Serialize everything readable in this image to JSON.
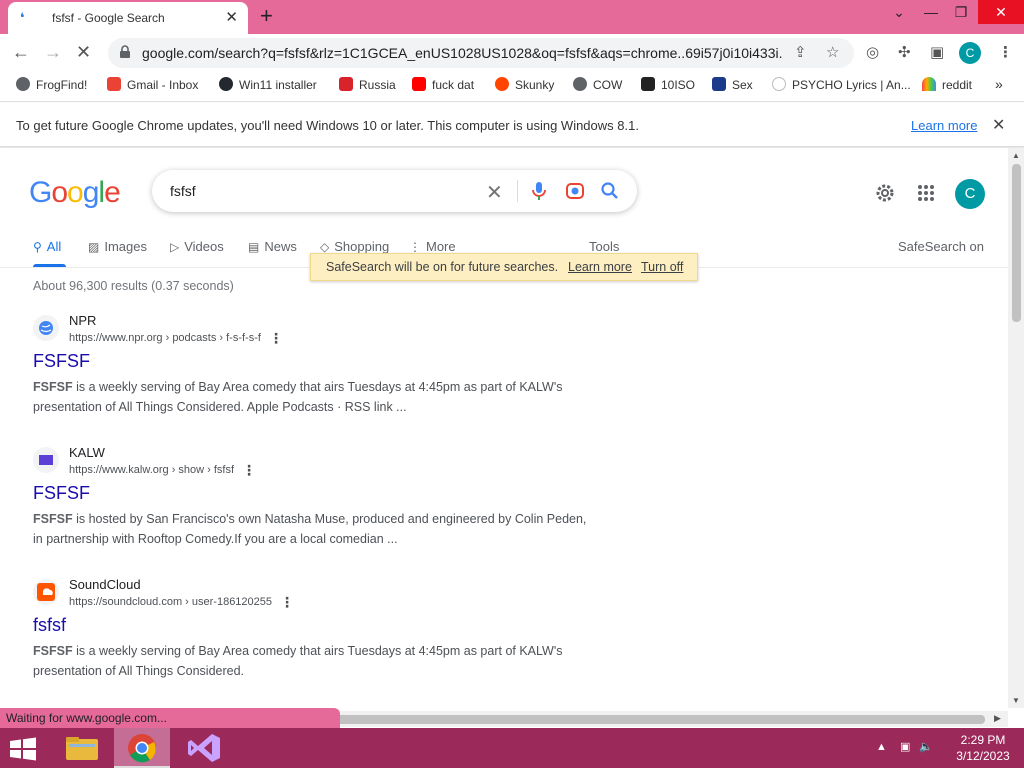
{
  "browser": {
    "tab_title": "fsfsf - Google Search",
    "tab_favicon": "google-loading-icon",
    "url": "google.com/search?q=fsfsf&rlz=1C1GCEA_enUS1028US1028&oq=fsfsf&aqs=chrome..69i57j0i10i433i...",
    "profile_initial": "C",
    "accent_color": "#e56a9a"
  },
  "bookmarks": [
    {
      "label": "FrogFind!",
      "icon": "globe-icon"
    },
    {
      "label": "Gmail - Inbox",
      "icon": "gmail-icon"
    },
    {
      "label": "Win11 installer",
      "icon": "github-icon"
    },
    {
      "label": "Russia",
      "icon": "red-square-icon"
    },
    {
      "label": "fuck dat",
      "icon": "youtube-icon"
    },
    {
      "label": "Skunky",
      "icon": "reddit-icon"
    },
    {
      "label": "COW",
      "icon": "globe-icon"
    },
    {
      "label": "10ISO",
      "icon": "building-icon"
    },
    {
      "label": "Sex",
      "icon": "s-logo-icon"
    },
    {
      "label": "PSYCHO Lyrics | An...",
      "icon": "spinner-icon"
    },
    {
      "label": "reddit",
      "icon": "rainbow-icon"
    }
  ],
  "infobar": {
    "message": "To get future Google Chrome updates, you'll need Windows 10 or later. This computer is using Windows 8.1.",
    "link": "Learn more"
  },
  "search": {
    "query": "fsfsf",
    "logo": "Google",
    "avatar_initial": "C",
    "tabs": [
      {
        "label": "All",
        "icon": "search-icon",
        "active": true
      },
      {
        "label": "Images",
        "icon": "image-icon"
      },
      {
        "label": "Videos",
        "icon": "video-icon"
      },
      {
        "label": "News",
        "icon": "news-icon"
      },
      {
        "label": "Shopping",
        "icon": "tag-icon"
      },
      {
        "label": "More",
        "icon": "more-icon"
      }
    ],
    "tools": "Tools",
    "safesearch": "SafeSearch on",
    "safesearch_popup": {
      "text": "SafeSearch will be on for future searches.",
      "learn_more": "Learn more",
      "turn_off": "Turn off"
    },
    "stats": "About 96,300 results (0.37 seconds)"
  },
  "results": [
    {
      "site": "NPR",
      "cite": "https://www.npr.org › podcasts › f-s-f-s-f",
      "title": "FSFSF",
      "snippet_bold": "FSFSF",
      "snippet": " is a weekly serving of Bay Area comedy that airs Tuesdays at 4:45pm as part of KALW's presentation of All Things Considered. Apple Podcasts · RSS link ..."
    },
    {
      "site": "KALW",
      "cite": "https://www.kalw.org › show › fsfsf",
      "title": "FSFSF",
      "snippet_bold": "FSFSF",
      "snippet": " is hosted by San Francisco's own Natasha Muse, produced and engineered by Colin Peden, in partnership with Rooftop Comedy.If you are a local comedian ..."
    },
    {
      "site": "SoundCloud",
      "cite": "https://soundcloud.com › user-186120255",
      "title": "fsfsf",
      "snippet_bold": "FSFSF",
      "snippet": " is a weekly serving of Bay Area comedy that airs Tuesdays at 4:45pm as part of KALW's presentation of All Things Considered."
    }
  ],
  "status": "Waiting for www.google.com...",
  "taskbar": {
    "time": "2:29 PM",
    "date": "3/12/2023",
    "color": "#9b2a5b"
  }
}
